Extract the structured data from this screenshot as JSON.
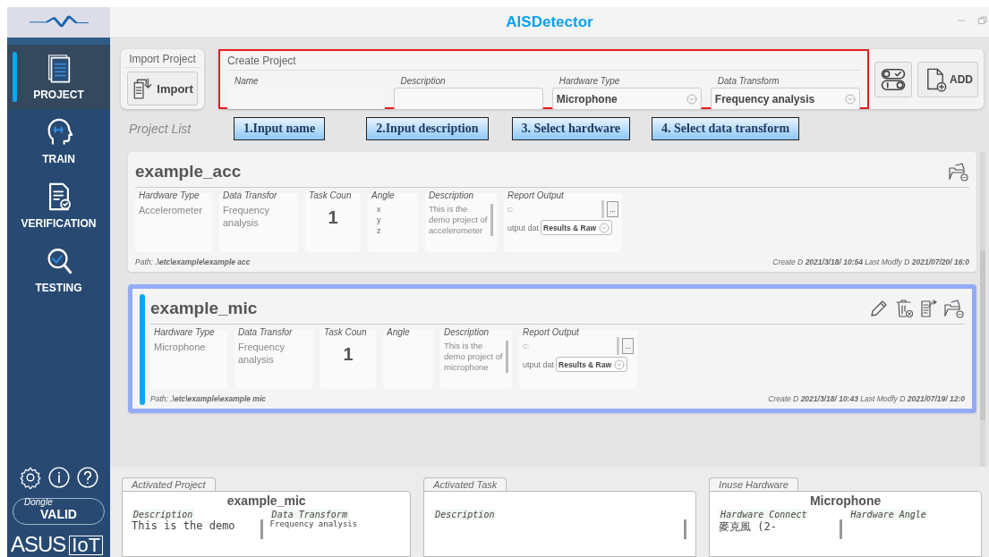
{
  "window": {
    "title": "AISDetector"
  },
  "sidebar": {
    "items": [
      {
        "label": "PROJECT",
        "selected": true
      },
      {
        "label": "TRAIN",
        "selected": false
      },
      {
        "label": "VERIFICATION",
        "selected": false
      },
      {
        "label": "TESTING",
        "selected": false
      }
    ],
    "dongle": {
      "label": "Dongle",
      "value": "VALID"
    },
    "brand": {
      "word": "ASUS",
      "suffix": "IoT"
    }
  },
  "import_project": {
    "title": "Import Project",
    "button": "Import"
  },
  "create_project": {
    "title": "Create Project",
    "highlighted": true,
    "fields": [
      {
        "kind": "underline",
        "label": "Name"
      },
      {
        "kind": "box",
        "label": "Description"
      },
      {
        "kind": "dropdown",
        "label": "Hardware Type",
        "value": "Microphone"
      },
      {
        "kind": "dropdown",
        "label": "Data Transform",
        "value": "Frequency analysis"
      }
    ],
    "add_button": "ADD"
  },
  "project_list": {
    "title": "Project List",
    "hints": [
      "1.Input name",
      "2.Input description",
      "3. Select hardware",
      "4. Select data transform"
    ],
    "projects": [
      {
        "name": "example_acc",
        "selected": false,
        "fields": [
          {
            "kind": "text",
            "label": "Hardware Type",
            "lines": [
              "Accelerometer"
            ]
          },
          {
            "kind": "text",
            "label": "Data Transfor",
            "lines": [
              "Frequency",
              "analysis"
            ]
          },
          {
            "kind": "count",
            "label": "Task Coun",
            "lines": [
              "1"
            ]
          },
          {
            "kind": "angle",
            "label": "Angle",
            "lines": [
              "x",
              "y",
              "z"
            ]
          },
          {
            "kind": "description",
            "label": "Description",
            "lines": [
              "This is the",
              "demo project of",
              "accelerometer"
            ]
          },
          {
            "kind": "report",
            "label": "Report Output",
            "lines": [
              "C:"
            ],
            "browse": "...",
            "option_label": "utput dat",
            "option": "Results & Raw"
          }
        ],
        "path_label": "Path:",
        "path": ".\\etc\\example\\example acc",
        "create_label": "Create D",
        "created": "2021/3/18/ 10:54",
        "modify_label": "Last Modfy D",
        "modified": "2021/07/20/ 16:0"
      },
      {
        "name": "example_mic",
        "selected": true,
        "fields": [
          {
            "kind": "text",
            "label": "Hardware Type",
            "lines": [
              "Microphone"
            ]
          },
          {
            "kind": "text",
            "label": "Data Transfor",
            "lines": [
              "Frequency",
              "analysis"
            ]
          },
          {
            "kind": "count",
            "label": "Task Coun",
            "lines": [
              "1"
            ]
          },
          {
            "kind": "angle",
            "label": "Angle"
          },
          {
            "kind": "description",
            "label": "Description",
            "lines": [
              "This is the",
              "demo project of",
              "microphone"
            ]
          },
          {
            "kind": "report",
            "label": "Report Output",
            "lines": [
              "C:"
            ],
            "browse": "...",
            "option_label": "utput dat",
            "option": "Results & Raw"
          }
        ],
        "path_label": "Path:",
        "path": ".\\etc\\example\\example mic",
        "create_label": "Create D",
        "created": "2021/3/18/ 10:43",
        "modify_label": "Last Modfy D",
        "modified": "2021/07/19/ 12:0"
      }
    ]
  },
  "status": [
    {
      "tab": "Activated Project",
      "title": "example_mic",
      "fields": [
        {
          "label": "Description",
          "value": "This is the demo",
          "kind": "mono"
        },
        {
          "label": "Data Transform",
          "value": "Frequency analysis",
          "kind": "small"
        }
      ]
    },
    {
      "tab": "Activated Task",
      "fields": [
        {
          "label": "Description",
          "kind": "mono"
        }
      ]
    },
    {
      "tab": "Inuse Hardware",
      "title": "Microphone",
      "fields": [
        {
          "label": "Hardware Connect",
          "value": "麥克風 (2-",
          "kind": "mono"
        },
        {
          "label": "Hardware Angle",
          "kind": "small"
        }
      ]
    }
  ]
}
